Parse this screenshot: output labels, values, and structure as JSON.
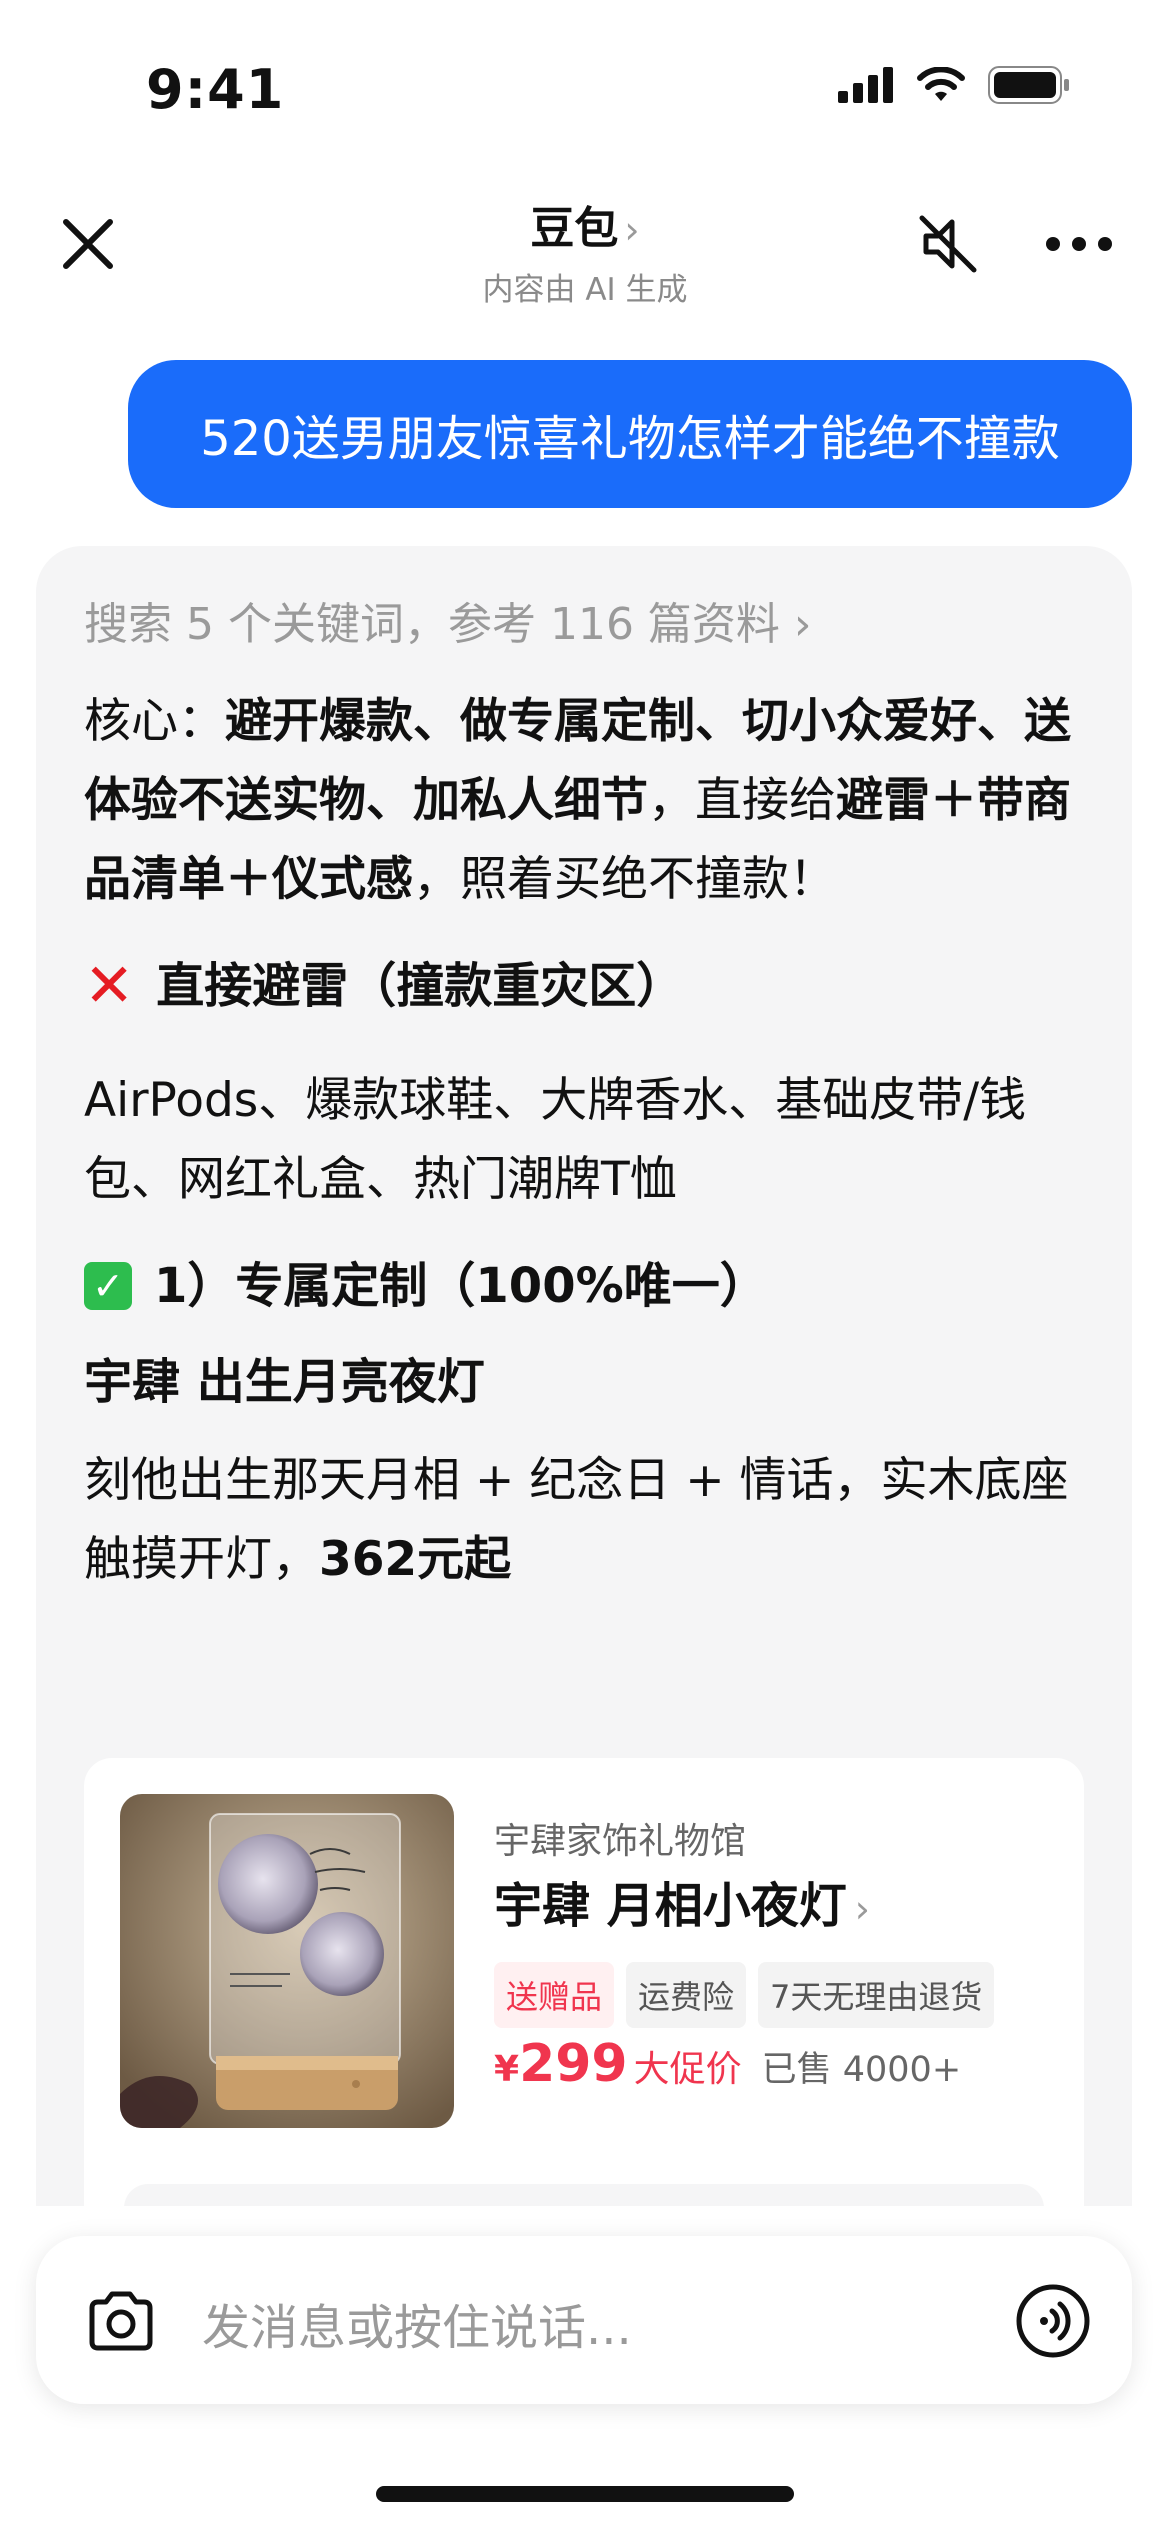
{
  "status_bar": {
    "time": "9:41"
  },
  "nav": {
    "title": "豆包",
    "subtitle": "内容由 AI 生成"
  },
  "user_message": "520送男朋友惊喜礼物怎样才能绝不撞款",
  "ai": {
    "search_summary": "搜索 5 个关键词，参考 116 篇资料 ›",
    "core_prefix": "核心：",
    "core_bold_1": "避开爆款、做专属定制、切小众爱好、送体验不送实物、加私人细节",
    "core_mid": "，直接给",
    "core_bold_2": "避雷＋带商品清单＋仪式感",
    "core_end": "，照着买绝不撞款！",
    "avoid_heading": "直接避雷（撞款重灾区）",
    "avoid_text": "AirPods、爆款球鞋、大牌香水、基础皮带/钱包、网红礼盒、热门潮牌T恤",
    "section1_heading": "1）专属定制（100%唯一）",
    "item1_title": "宇肆 出生月亮夜灯",
    "item1_desc": "刻他出生那天月相 + 纪念日 + 情话，实木底座触摸开灯，",
    "item1_price_bold": "362元起"
  },
  "product": {
    "shop": "宇肆家饰礼物馆",
    "name": "宇肆 月相小夜灯",
    "tags": [
      "送赠品",
      "运费险",
      "7天无理由退货"
    ],
    "price_symbol": "¥",
    "price": "299",
    "promo": "大促价",
    "sold": "已售 4000+"
  },
  "input": {
    "placeholder": "发消息或按住说话..."
  },
  "colors": {
    "accent": "#1a6cfa",
    "price": "#f0354e",
    "card_bg": "#f5f5f6"
  }
}
